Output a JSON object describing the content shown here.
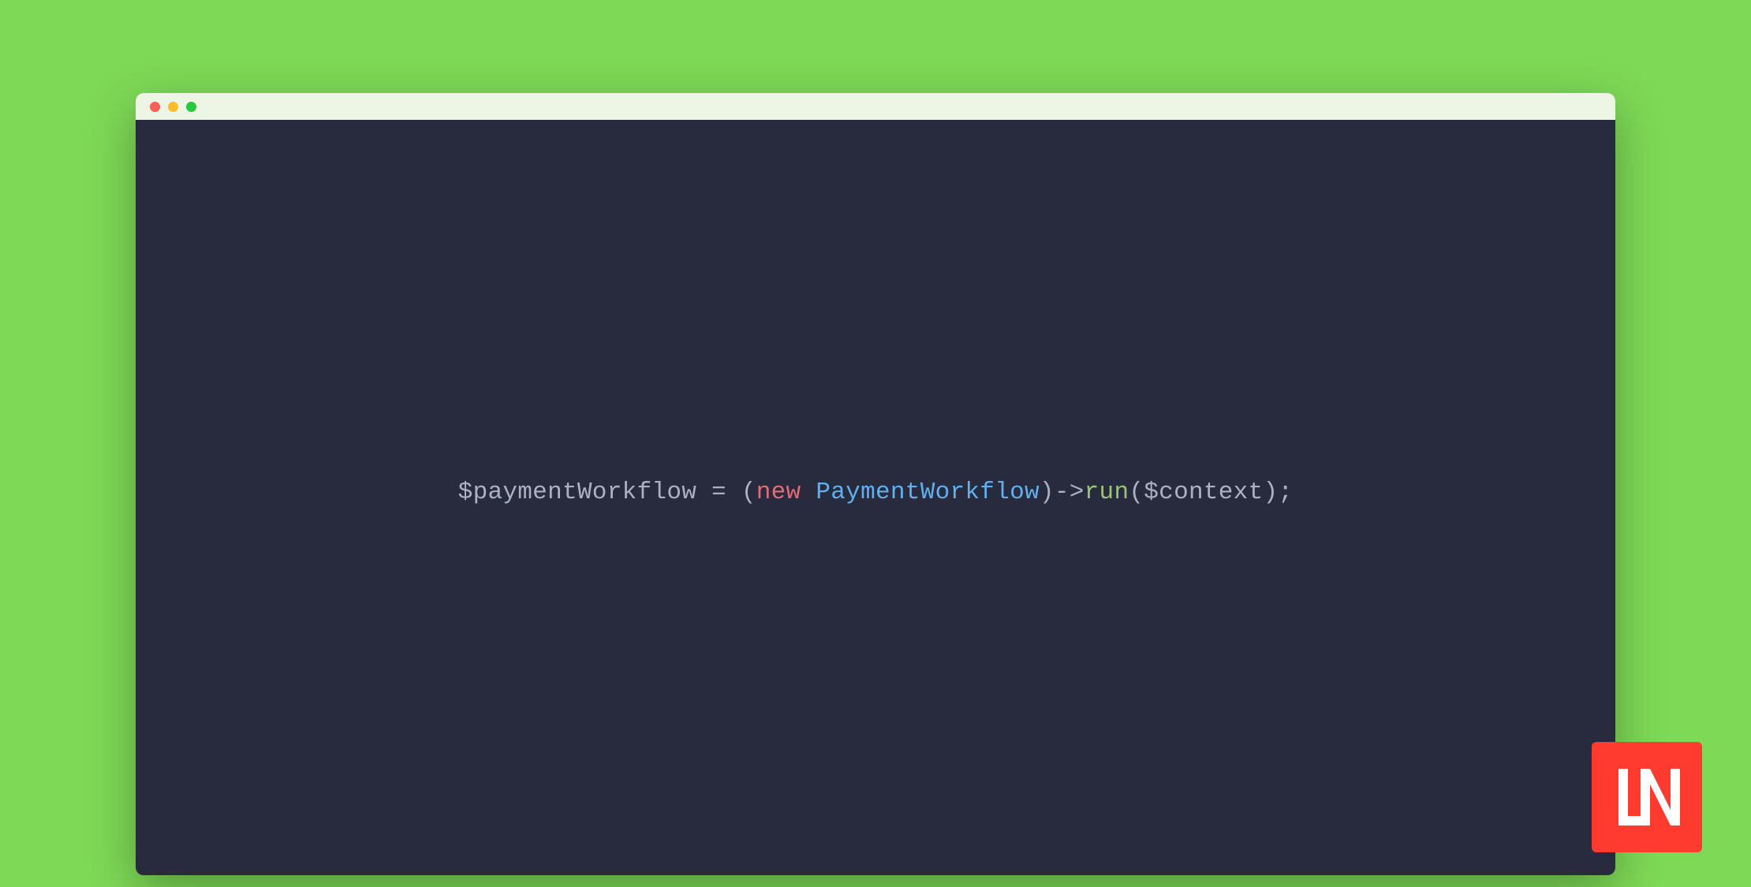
{
  "code": {
    "variable": "$paymentWorkflow",
    "assign": " = ",
    "open_paren": "(",
    "keyword_new": "new",
    "space": " ",
    "class_name": "PaymentWorkflow",
    "close_paren": ")",
    "arrow": "->",
    "method": "run",
    "call_open": "(",
    "argument": "$context",
    "call_close": ")",
    "semicolon": ";"
  },
  "colors": {
    "background": "#7ed956",
    "terminal_bg": "#272b3d",
    "titlebar_bg": "#edf5e4",
    "badge_bg": "#ff3b2f"
  },
  "icons": {
    "close": "close-icon",
    "minimize": "minimize-icon",
    "maximize": "maximize-icon",
    "brand": "ln-logo-icon"
  }
}
